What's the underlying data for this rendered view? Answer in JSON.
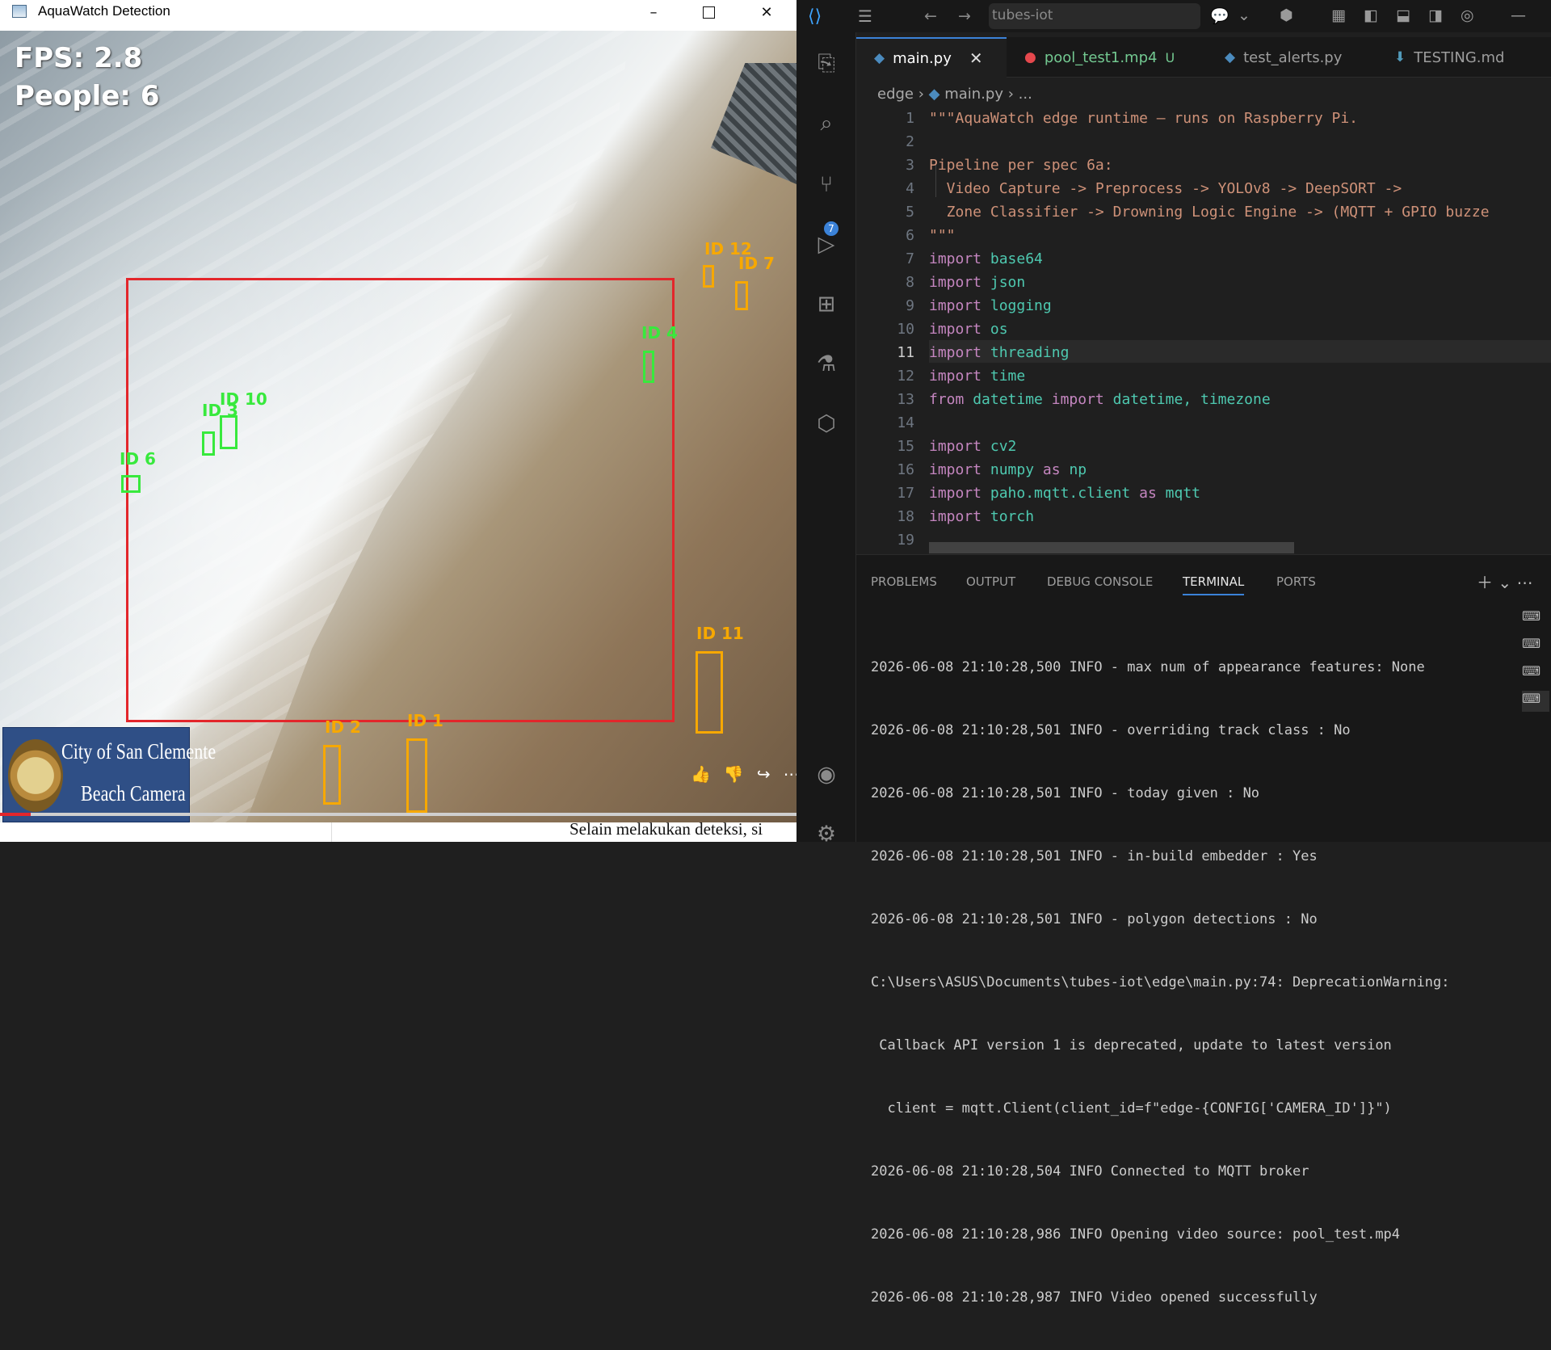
{
  "aqua_window": {
    "title": "AquaWatch Detection",
    "minimize": "–",
    "close": "✕"
  },
  "video": {
    "fps_text": "FPS: 2.8",
    "people_text": "People: 6",
    "zone_color": "#e3262b",
    "track_labels_green": [
      "ID 4",
      "ID 10",
      "ID 3",
      "ID 6"
    ],
    "track_labels_orange": [
      "ID 12",
      "ID 7",
      "ID 11",
      "ID 2",
      "ID 1"
    ],
    "logo_line1": "City of San Clemente",
    "logo_line2": "Beach Camera",
    "controls": [
      "👍",
      "👎",
      "↪",
      "⋯"
    ]
  },
  "doc_text": "Selain melakukan deteksi, si",
  "vscode": {
    "search": "tubes-iot",
    "tabs": [
      {
        "label": "main.py",
        "close": "✕"
      },
      {
        "label": "pool_test1.mp4",
        "mod": "U"
      },
      {
        "label": "test_alerts.py"
      },
      {
        "label": "TESTING.md"
      }
    ],
    "breadcrumb": [
      "edge",
      "main.py",
      "..."
    ],
    "source_control_badge": "7",
    "line_numbers": [
      "1",
      "2",
      "3",
      "4",
      "5",
      "6",
      "7",
      "8",
      "9",
      "10",
      "11",
      "12",
      "13",
      "14",
      "15",
      "16",
      "17",
      "18",
      "19"
    ],
    "current_line": "11",
    "code": {
      "l1": "\"\"\"AquaWatch edge runtime — runs on Raspberry Pi.",
      "l3": "Pipeline per spec 6a:",
      "l4": "  Video Capture -> Preprocess -> YOLOv8 -> DeepSORT ->",
      "l5": "  Zone Classifier -> Drowning Logic Engine -> (MQTT + GPIO buzze",
      "l6": "\"\"\"",
      "imports": [
        "base64",
        "json",
        "logging",
        "os",
        "threading",
        "time"
      ],
      "l13_kw1": "from",
      "l13_mod": "datetime",
      "l13_kw2": "import",
      "l13_rest": "datetime, timezone",
      "l15": "cv2",
      "l16_mod": "numpy",
      "l16_as": "as",
      "l16_alias": "np",
      "l17_mod": "paho.mqtt.client",
      "l17_as": "as",
      "l17_alias": "mqtt",
      "l18": "torch",
      "kw_import": "import"
    },
    "panel_tabs": [
      "PROBLEMS",
      "OUTPUT",
      "DEBUG CONSOLE",
      "TERMINAL",
      "PORTS"
    ],
    "active_panel_tab": "TERMINAL",
    "terminal_lines": [
      "2026-06-08 21:10:28,500 INFO - max num of appearance features: None",
      "2026-06-08 21:10:28,501 INFO - overriding track class : No",
      "2026-06-08 21:10:28,501 INFO - today given : No",
      "2026-06-08 21:10:28,501 INFO - in-build embedder : Yes",
      "2026-06-08 21:10:28,501 INFO - polygon detections : No",
      "C:\\Users\\ASUS\\Documents\\tubes-iot\\edge\\main.py:74: DeprecationWarning:",
      " Callback API version 1 is deprecated, update to latest version",
      "  client = mqtt.Client(client_id=f\"edge-{CONFIG['CAMERA_ID']}\")",
      "2026-06-08 21:10:28,504 INFO Connected to MQTT broker",
      "2026-06-08 21:10:28,986 INFO Opening video source: pool_test.mp4",
      "2026-06-08 21:10:28,987 INFO Video opened successfully"
    ],
    "colors": {
      "accent": "#3b82d8",
      "keyword": "#c586c0",
      "module": "#4ec9b0",
      "string": "#ce9178"
    }
  }
}
